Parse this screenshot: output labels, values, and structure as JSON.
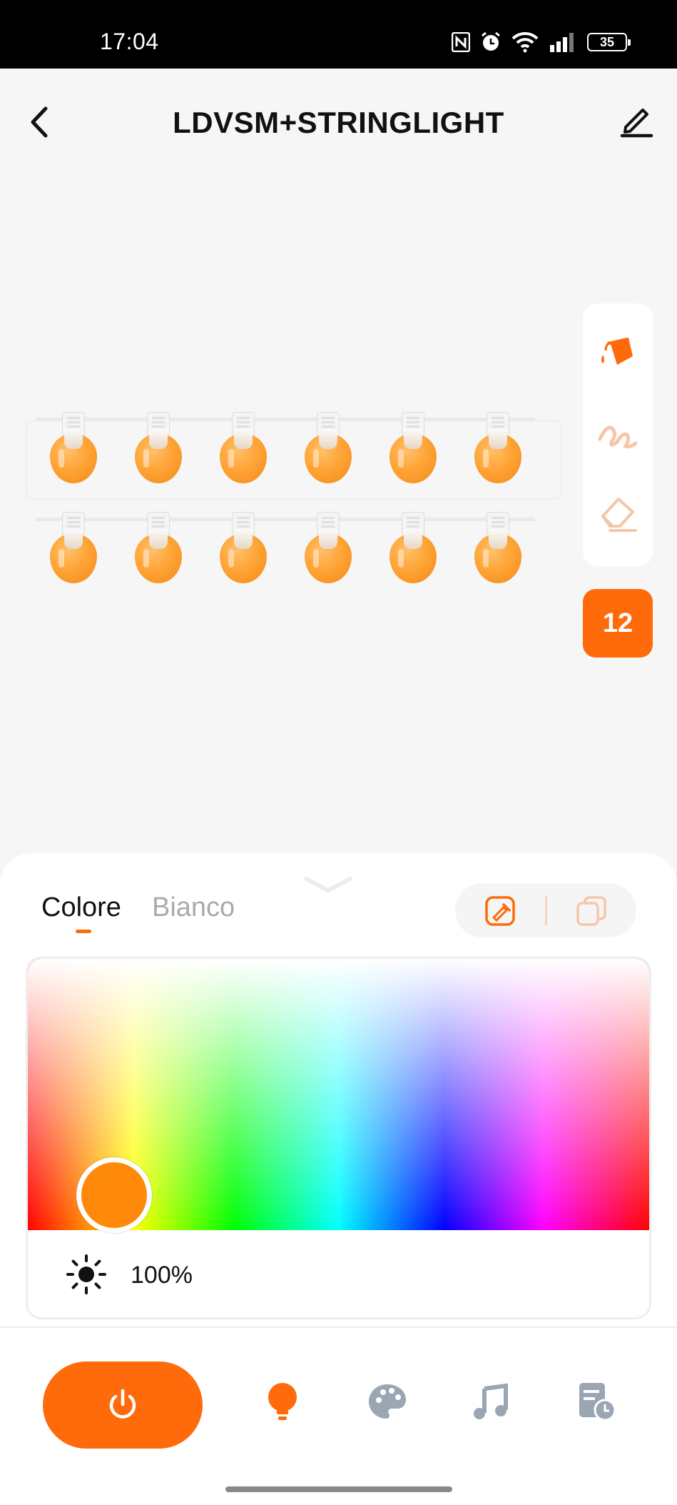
{
  "status_bar": {
    "time": "17:04",
    "battery": "35"
  },
  "header": {
    "title": "LDVSM+STRINGLIGHT"
  },
  "bulbs": {
    "rows": 2,
    "per_row": 6,
    "color": "#ffa436"
  },
  "tool_panel": {
    "tools": [
      "paint-bucket-icon",
      "brush-icon",
      "eraser-icon"
    ],
    "selected_count": "12"
  },
  "sheet": {
    "tabs": [
      {
        "label": "Colore",
        "active": true
      },
      {
        "label": "Bianco",
        "active": false
      }
    ],
    "picker": {
      "selected_color": "#ff8a0a",
      "brightness": "100%"
    }
  },
  "bottom_nav": {
    "items": [
      "power-icon",
      "bulb-icon",
      "palette-icon",
      "music-icon",
      "schedule-icon"
    ],
    "accent": "#ff6a0a",
    "inactive": "#9aa6b4"
  }
}
